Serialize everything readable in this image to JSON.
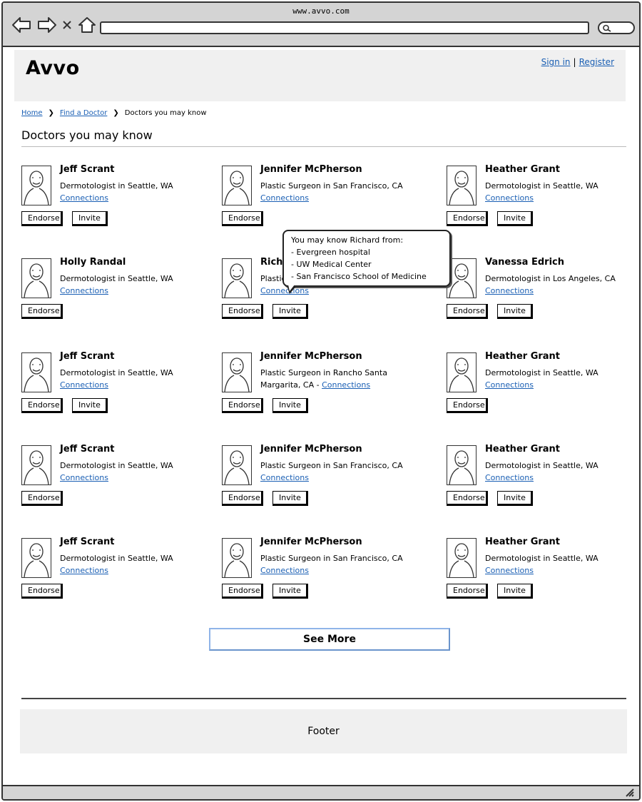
{
  "browser": {
    "url_title": "www.avvo.com"
  },
  "header": {
    "logo": "Avvo",
    "sign_in": "Sign in",
    "separator": "|",
    "register": "Register"
  },
  "breadcrumb": {
    "items": [
      "Home",
      "Find a Doctor",
      "Doctors you may know"
    ]
  },
  "page_title": "Doctors you may know",
  "buttons": {
    "endorse": "Endorse",
    "invite": "Invite"
  },
  "doctors": [
    {
      "name": "Jeff Scrant",
      "desc": "Dermotologist in Seattle, WA",
      "connections": "Connections",
      "has_invite": true
    },
    {
      "name": "Jennifer McPherson",
      "desc": "Plastic Surgeon in San Francisco, CA",
      "connections": "Connections",
      "has_invite": false
    },
    {
      "name": "Heather Grant",
      "desc": "Dermotologist in Seattle, WA",
      "connections": "Connections",
      "has_invite": true
    },
    {
      "name": "Holly Randal",
      "desc": "Dermotologist in Seattle, WA",
      "connections": "Connections",
      "has_invite": false
    },
    {
      "name": "Richa",
      "desc": "Plastic",
      "connections": "Connections",
      "has_invite": true
    },
    {
      "name": "Vanessa Edrich",
      "desc": "Dermotologist in Los Angeles, CA",
      "connections": "Connections",
      "has_invite": true
    },
    {
      "name": "Jeff Scrant",
      "desc": "Dermotologist in Seattle, WA",
      "connections": "Connections",
      "has_invite": true
    },
    {
      "name": "Jennifer McPherson",
      "desc": "Plastic Surgeon in Rancho Santa Margarita, CA - ",
      "connections": "Connections",
      "has_invite": true
    },
    {
      "name": "Heather Grant",
      "desc": "Dermotologist in Seattle, WA",
      "connections": "Connections",
      "has_invite": false
    },
    {
      "name": "Jeff Scrant",
      "desc": "Dermotologist in Seattle, WA",
      "connections": "Connections",
      "has_invite": false
    },
    {
      "name": "Jennifer McPherson",
      "desc": "Plastic Surgeon in San Francisco, CA",
      "connections": "Connections",
      "has_invite": true
    },
    {
      "name": "Heather Grant",
      "desc": "Dermotologist in Seattle, WA",
      "connections": "Connections",
      "has_invite": true
    },
    {
      "name": "Jeff Scrant",
      "desc": "Dermotologist in Seattle, WA",
      "connections": "Connections",
      "has_invite": false
    },
    {
      "name": "Jennifer McPherson",
      "desc": "Plastic Surgeon in San Francisco, CA",
      "connections": "Connections",
      "has_invite": true
    },
    {
      "name": "Heather Grant",
      "desc": "Dermotologist in Seattle, WA",
      "connections": "Connections",
      "has_invite": true
    }
  ],
  "tooltip": {
    "heading": "You may know Richard from:",
    "lines": [
      "- Evergreen hospital",
      "- UW Medical Center",
      "- San Francisco School of Medicine"
    ]
  },
  "see_more": "See More",
  "footer": "Footer",
  "colors": {
    "link": "#1a5fb4",
    "header_bg": "#f0f0f0",
    "chrome_bg": "#d4d4d4",
    "see_more_border": "#8fb4e8"
  }
}
